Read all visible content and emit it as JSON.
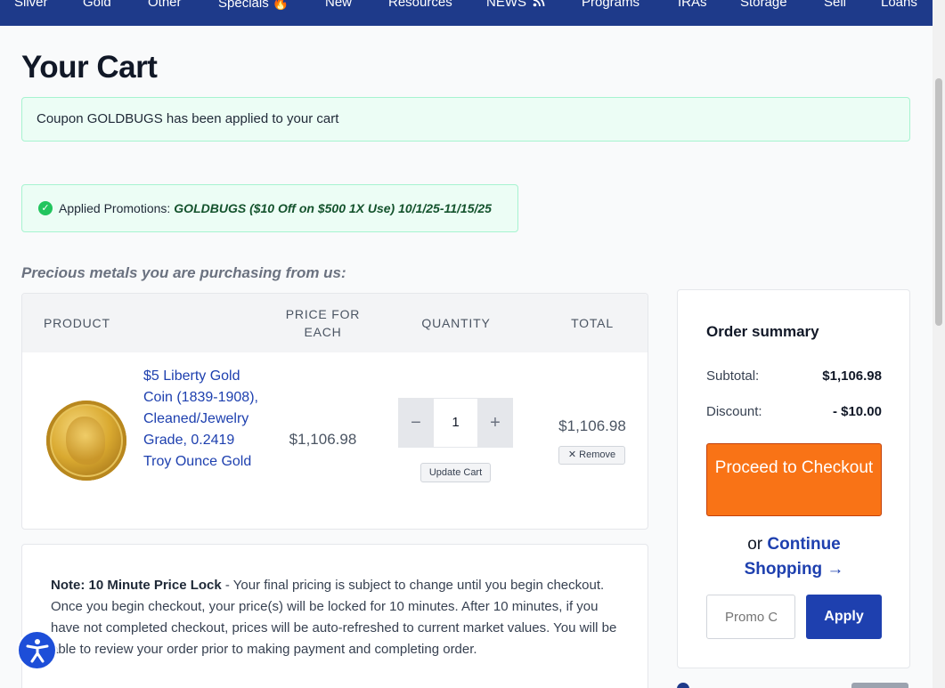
{
  "nav": {
    "items": [
      "Silver",
      "Gold",
      "Other",
      "Specials 🔥",
      "New",
      "Resources",
      "NEWS",
      "Programs",
      "IRAs",
      "Storage",
      "Sell",
      "Loans"
    ]
  },
  "page": {
    "title": "Your Cart",
    "coupon_alert": "Coupon GOLDBUGS has been applied to your cart",
    "promotions_label": "Applied Promotions:",
    "promotions_value": "GOLDBUGS ($10 Off on $500 1X Use) 10/1/25-11/15/25",
    "section_heading": "Precious metals you are purchasing from us:"
  },
  "cart": {
    "headers": {
      "product": "PRODUCT",
      "price_line1": "PRICE FOR",
      "price_line2": "EACH",
      "quantity": "QUANTITY",
      "total": "TOTAL"
    },
    "item": {
      "name": "$5 Liberty Gold Coin (1839-1908), Cleaned/Jewelry Grade, 0.2419 Troy Ounce Gold",
      "price_each": "$1,106.98",
      "quantity": "1",
      "decrement": "−",
      "increment": "+",
      "update_label": "Update Cart",
      "total": "$1,106.98",
      "remove_label": "✕ Remove"
    }
  },
  "note": {
    "label": "Note: 10 Minute Price Lock",
    "text": " - Your final pricing is subject to change until you begin checkout. Once you begin checkout, your price(s) will be locked for 10 minutes. After 10 minutes, if you have not completed checkout, prices will be auto-refreshed to current market values. You will be able to review your order prior to making payment and completing order."
  },
  "summary": {
    "heading": "Order summary",
    "subtotal_label": "Subtotal:",
    "subtotal_value": "$1,106.98",
    "discount_label": "Discount:",
    "discount_value": "- $10.00",
    "checkout_label": "Proceed to Checkout",
    "continue_prefix": "or",
    "continue_link": "Continue Shopping →",
    "promo_placeholder": "Promo Code",
    "apply_label": "Apply"
  },
  "colors": {
    "nav_bg": "#1e3a8a",
    "checkout": "#f97316",
    "apply": "#1e40af",
    "link": "#1e40af",
    "success_bg": "#ecfdf5"
  },
  "icons": [
    "rss-icon",
    "check-circle-icon",
    "accessibility-icon",
    "close-icon"
  ]
}
